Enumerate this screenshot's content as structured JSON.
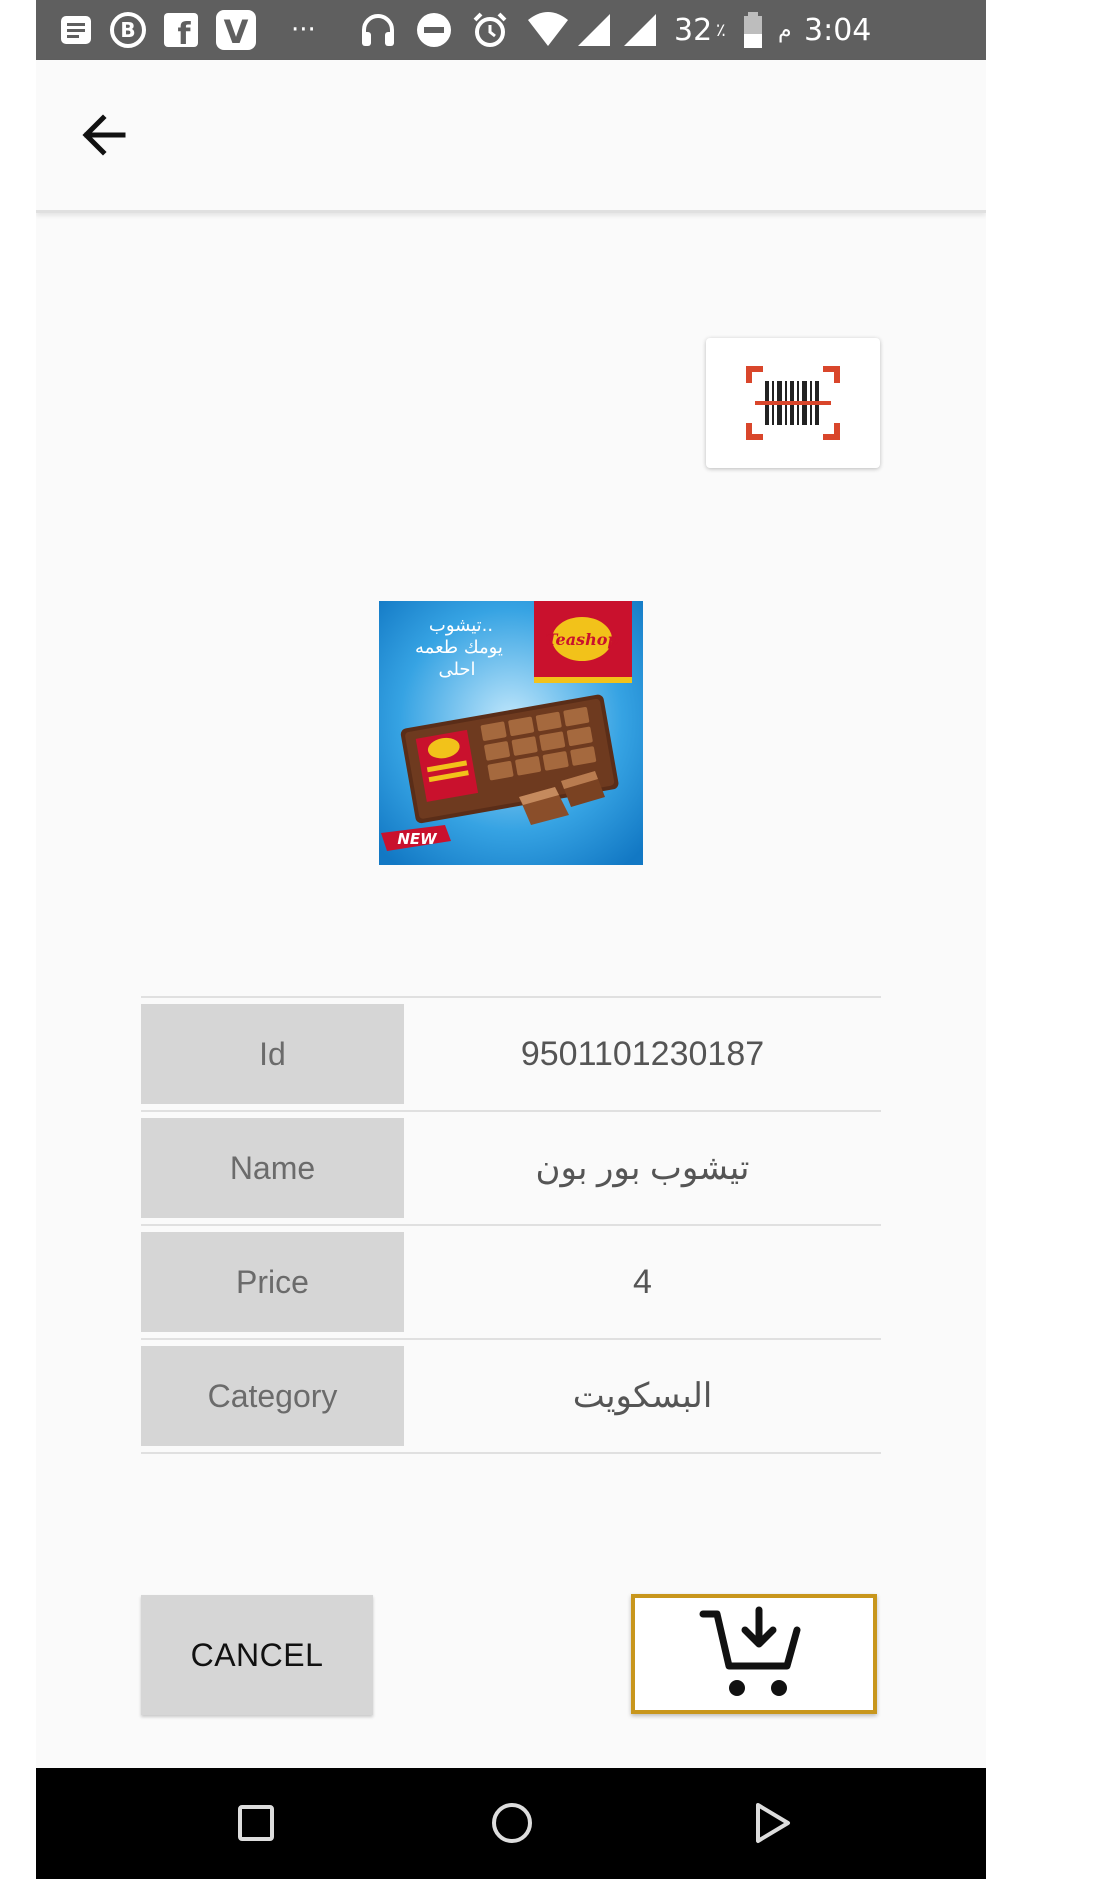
{
  "status_bar": {
    "battery_percent": "32",
    "percent_sign": "٪",
    "time": "3:04",
    "am_pm": "م",
    "dots": "···"
  },
  "toolbar": {
    "back_icon": "arrow-back-icon"
  },
  "scan_button": {
    "icon": "barcode-scan-icon",
    "accent_color": "#d9462b"
  },
  "product_image": {
    "tagline_line1": "تيشوب..",
    "tagline_line2": "يومك طعمه",
    "tagline_line3": "احلى",
    "brand": "Teashop",
    "badge": "NEW"
  },
  "details": {
    "rows": [
      {
        "label": "Id",
        "value": "9501101230187"
      },
      {
        "label": "Name",
        "value": "تيشوب بور بون"
      },
      {
        "label": "Price",
        "value": "4"
      },
      {
        "label": "Category",
        "value": "البسكويت"
      }
    ]
  },
  "actions": {
    "cancel_label": "CANCEL",
    "cart_icon": "add-to-cart-icon",
    "cart_border_color": "#c8961c"
  },
  "nav_bar": {
    "recents_icon": "square-icon",
    "home_icon": "circle-icon",
    "back_icon": "triangle-icon"
  }
}
